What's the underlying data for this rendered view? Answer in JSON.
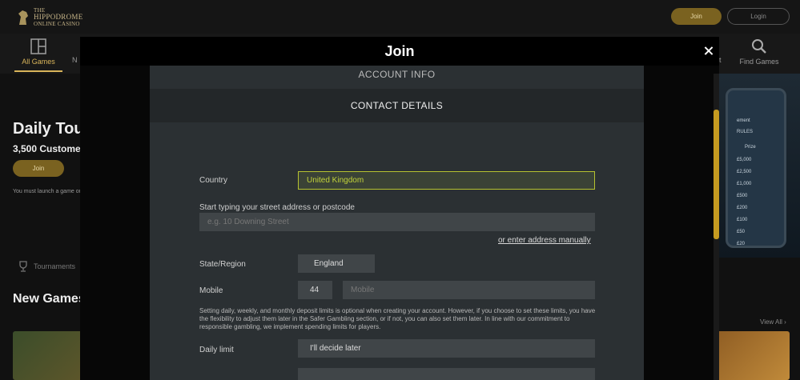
{
  "site": {
    "logo_line1": "THE",
    "logo_line2": "HIPPODROME",
    "logo_line3": "ONLINE CASINO",
    "join_label": "Join",
    "login_label": "Login",
    "nav": {
      "all_games": "All Games",
      "partial_new": "N",
      "partial_t": "t",
      "find_games": "Find Games"
    },
    "promo": {
      "title": "Daily Tou",
      "subtitle": "3,500 Custome",
      "join_label": "Join",
      "note": "You must launch a game on"
    },
    "tournaments_label": "Tournaments",
    "new_games_label": "New Games",
    "view_all_label": "View All ›",
    "side_promo": {
      "heading": "ement",
      "col_rules": "RULES",
      "col_prize": "Prize",
      "prizes": [
        "£5,000",
        "£2,500",
        "£1,000",
        "£500",
        "£200",
        "£100",
        "£50",
        "£20"
      ]
    }
  },
  "modal": {
    "title": "Join",
    "section_account": "ACCOUNT INFO",
    "section_contact": "CONTACT DETAILS",
    "country_label": "Country",
    "country_value": "United Kingdom",
    "address_label": "Start typing your street address or postcode",
    "address_placeholder": "e.g. 10 Downing Street",
    "manual_link": "or enter address manually",
    "state_label": "State/Region",
    "state_value": "England",
    "mobile_label": "Mobile",
    "mobile_code": "44",
    "mobile_placeholder": "Mobile",
    "disclaimer": "Setting daily, weekly, and monthly deposit limits is optional when creating your account. However, if you choose to set these limits, you have the flexibility to adjust them later in the Safer Gambling section, or if not, you can also set them later. In line with our commitment to responsible gambling, we implement spending limits for players.",
    "daily_limit_label": "Daily limit",
    "daily_limit_value": "I'll decide later"
  },
  "colors": {
    "gold": "#c59a20",
    "country_border": "#b6c230",
    "panel": "#2b3033",
    "field": "#404548"
  }
}
